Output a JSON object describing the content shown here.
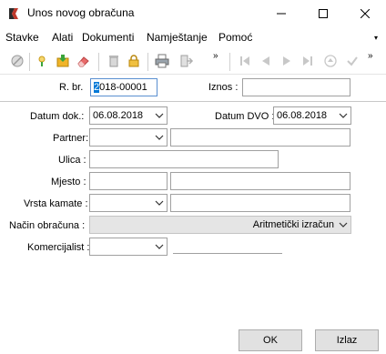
{
  "window": {
    "title": "Unos novog obračuna",
    "minimize_icon": "minimize-icon",
    "maximize_icon": "maximize-icon",
    "close_icon": "close-icon"
  },
  "menu": {
    "items": [
      "Stavke",
      "Alati",
      "Dokumenti",
      "Namještanje",
      "Pomoć"
    ],
    "overflow": "▾"
  },
  "toolbar": {
    "more": "»",
    "icons": [
      "cancel-icon",
      "new-icon",
      "import-icon",
      "eraser-icon",
      "delete-icon",
      "lock-icon",
      "print-icon",
      "exit-icon",
      "first-icon",
      "prev-icon",
      "next-icon",
      "last-icon",
      "up-icon",
      "confirm-icon"
    ]
  },
  "header": {
    "rbr_label": "R. br.",
    "rbr_value_first": "2",
    "rbr_value_rest": "018-00001",
    "iznos_label": "Iznos :",
    "iznos_value": ""
  },
  "form": {
    "datum_dok_label": "Datum dok.:",
    "datum_dok_value": "06.08.2018",
    "datum_dvo_label": "Datum DVO :",
    "datum_dvo_value": "06.08.2018",
    "partner_label": "Partner:",
    "partner_value": "",
    "partner_name": "",
    "ulica_label": "Ulica :",
    "ulica_value": "",
    "mjesto_label": "Mjesto :",
    "mjesto_code": "",
    "mjesto_name": "",
    "vrsta_kamate_label": "Vrsta kamate :",
    "vrsta_kamate_value": "",
    "vrsta_kamate_name": "",
    "nacin_obracuna_label": "Način obračuna :",
    "nacin_obracuna_value": "Aritmetički izračun",
    "komercijalist_label": "Komercijalist :",
    "komercijalist_value": "",
    "komercijalist_name": ""
  },
  "buttons": {
    "ok": "OK",
    "izlaz": "Izlaz"
  }
}
